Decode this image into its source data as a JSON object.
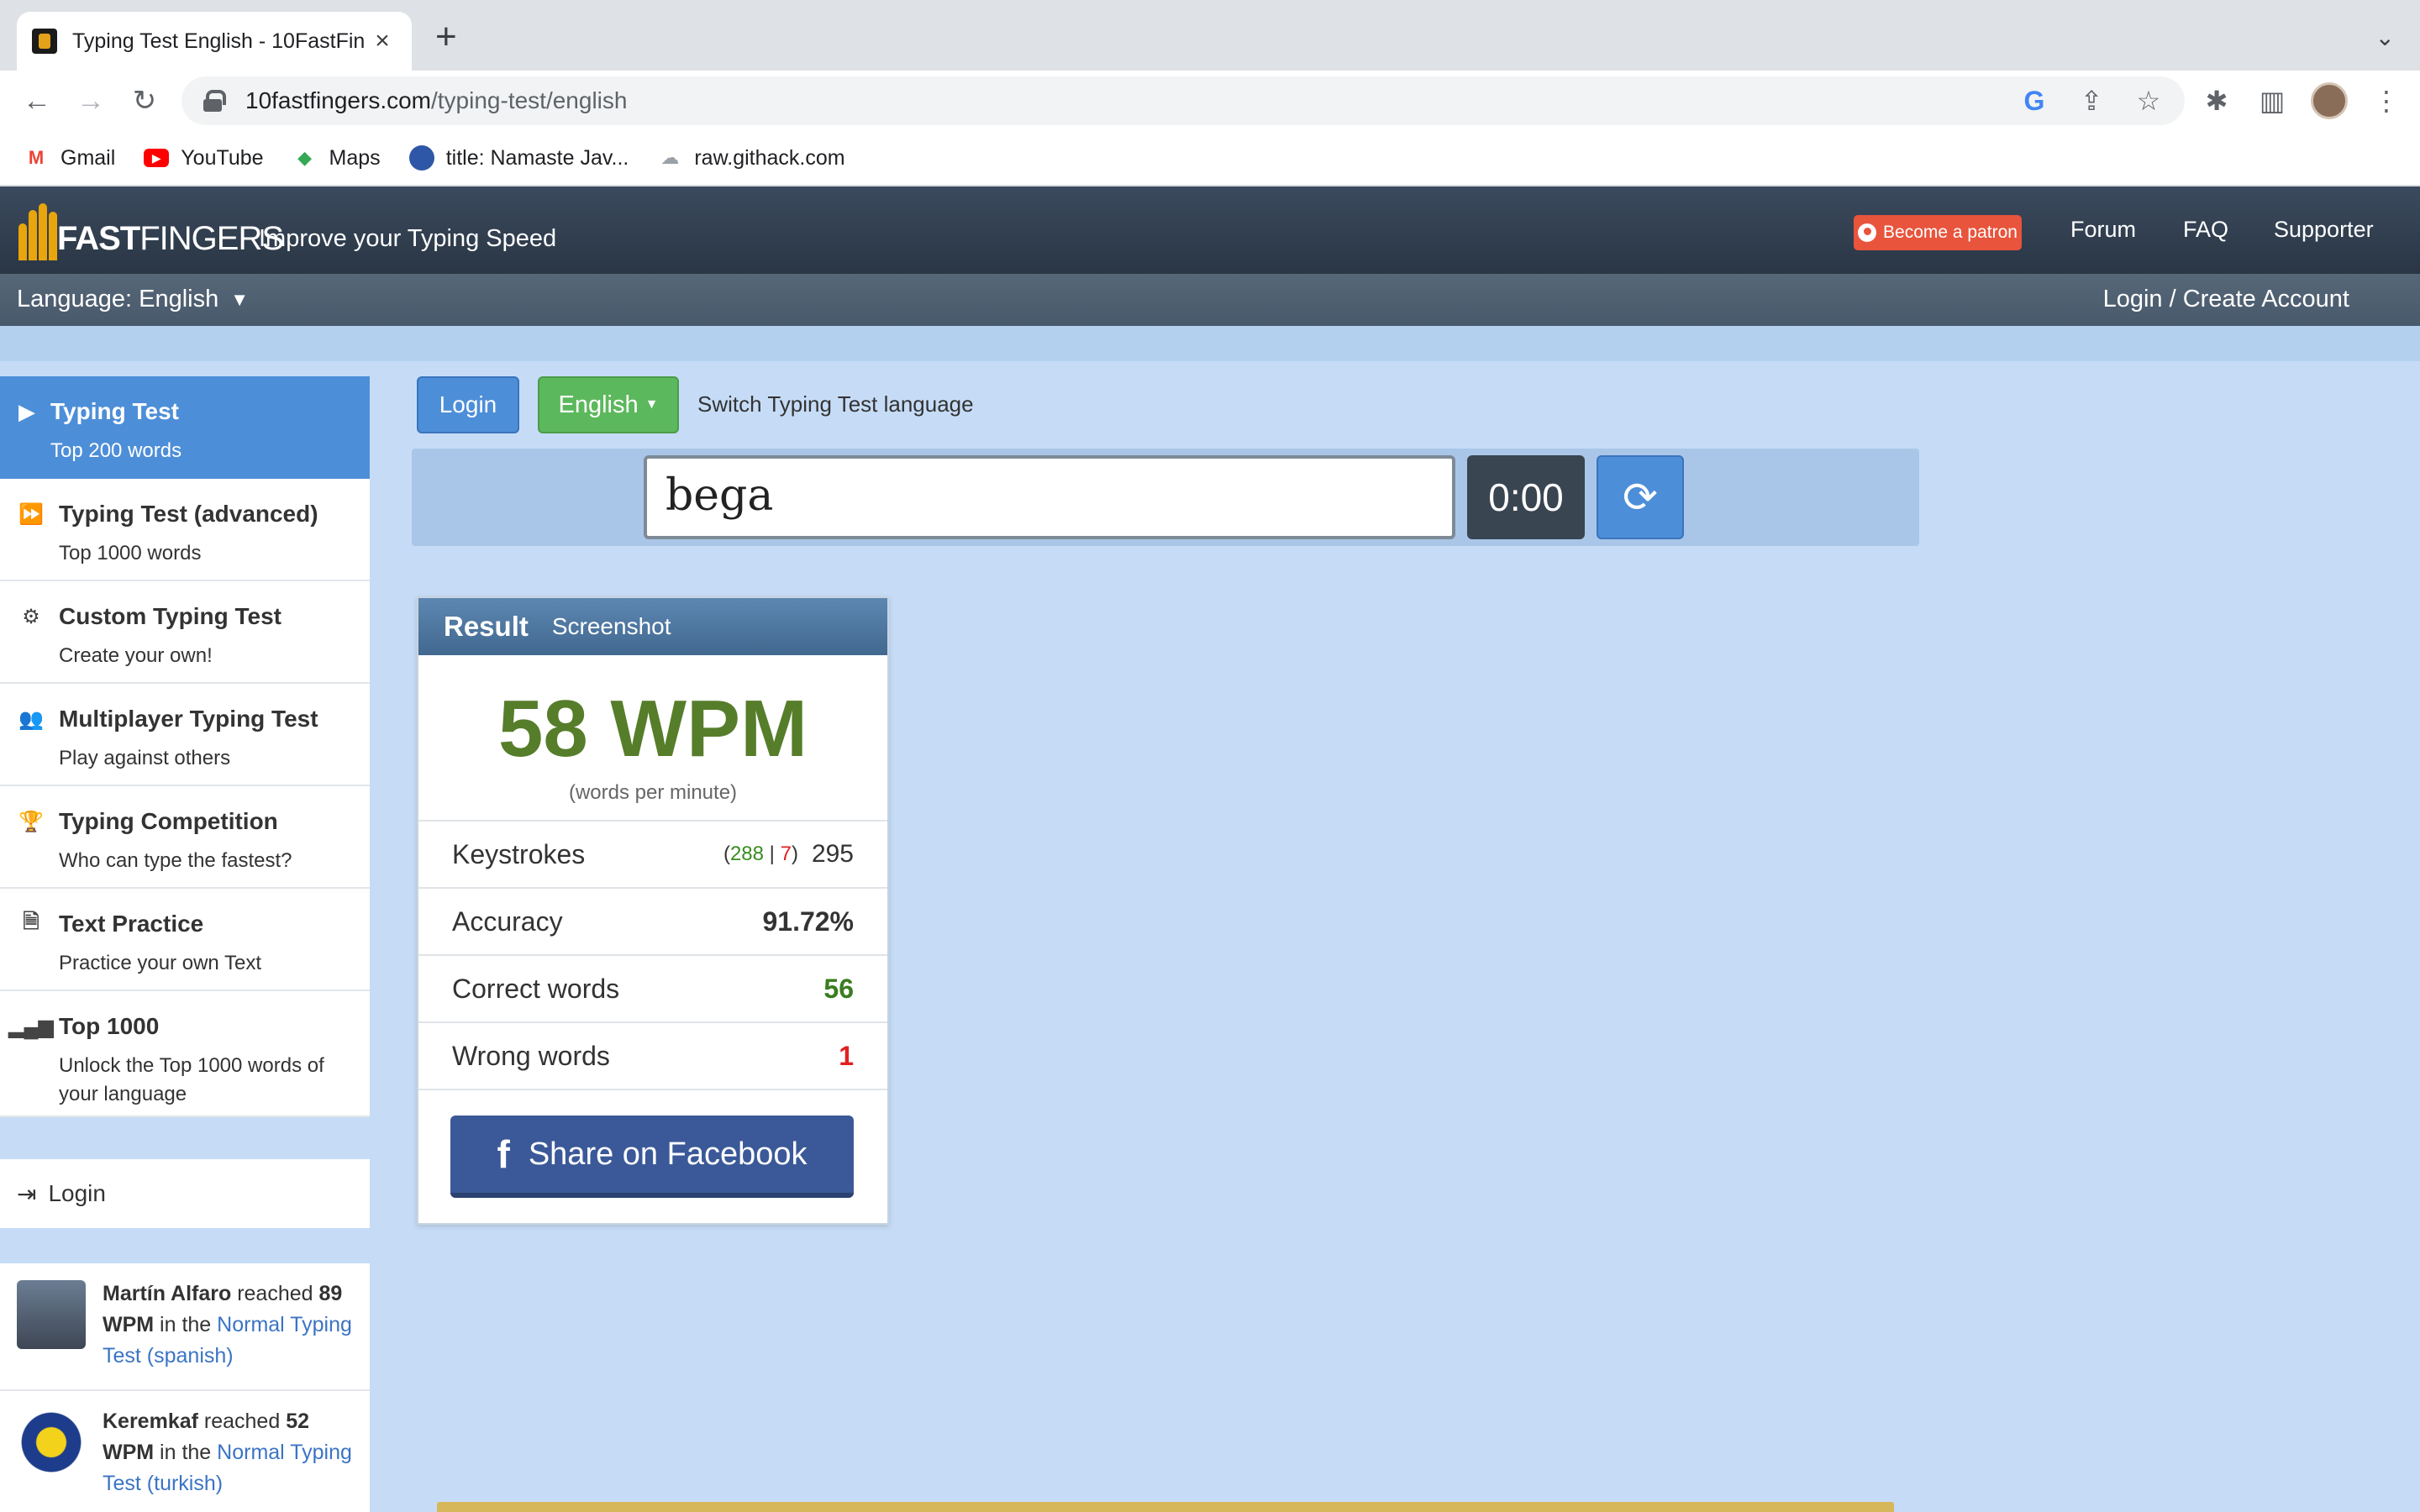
{
  "browser": {
    "tab_title": "Typing Test English - 10FastFin",
    "url_host": "10fastfingers.com",
    "url_path": "/typing-test/english",
    "bookmarks": [
      {
        "label": "Gmail",
        "icon": "gmail-icon"
      },
      {
        "label": "YouTube",
        "icon": "youtube-icon"
      },
      {
        "label": "Maps",
        "icon": "maps-icon"
      },
      {
        "label": "title: Namaste Jav...",
        "icon": "avatar-icon"
      },
      {
        "label": "raw.githack.com",
        "icon": "cloud-icon"
      }
    ]
  },
  "header": {
    "logo_prefix": "FAST",
    "logo_suffix": "FINGERS",
    "tagline": "Improve your Typing Speed",
    "patron": "Become a patron",
    "nav": [
      "Forum",
      "FAQ",
      "Supporter"
    ],
    "language_label": "Language: English",
    "login_create": "Login / Create Account"
  },
  "sidebar": {
    "items": [
      {
        "title": "Typing Test",
        "sub": "Top 200 words",
        "icon": "play-icon"
      },
      {
        "title": "Typing Test (advanced)",
        "sub": "Top 1000 words",
        "icon": "fast-forward-icon"
      },
      {
        "title": "Custom Typing Test",
        "sub": "Create your own!",
        "icon": "gears-icon"
      },
      {
        "title": "Multiplayer Typing Test",
        "sub": "Play against others",
        "icon": "users-icon"
      },
      {
        "title": "Typing Competition",
        "sub": "Who can type the fastest?",
        "icon": "trophy-icon"
      },
      {
        "title": "Text Practice",
        "sub": "Practice your own Text",
        "icon": "document-icon"
      },
      {
        "title": "Top 1000",
        "sub": "Unlock the Top 1000 words of your language",
        "icon": "signal-icon"
      }
    ],
    "login": "Login"
  },
  "feed": [
    {
      "name": "Martín Alfaro",
      "reached": " reached ",
      "wpm": "89 WPM",
      "in_the": " in the ",
      "link": "Normal Typing Test (spanish)"
    },
    {
      "name": "Keremkaf",
      "reached": " reached ",
      "wpm": "52 WPM",
      "in_the": " in the ",
      "link": "Normal Typing Test (turkish)"
    }
  ],
  "main": {
    "login_button": "Login",
    "language_button": "English",
    "switch_text": "Switch Typing Test language",
    "input_value": "bega",
    "timer": "0:00"
  },
  "result": {
    "title": "Result",
    "screenshot": "Screenshot",
    "wpm": "58 WPM",
    "wpm_sub": "(words per minute)",
    "keystrokes_label": "Keystrokes",
    "keystrokes_correct": "288",
    "keystrokes_wrong": "7",
    "keystrokes_total": "295",
    "accuracy_label": "Accuracy",
    "accuracy_value": "91.72%",
    "correct_label": "Correct words",
    "correct_value": "56",
    "wrong_label": "Wrong words",
    "wrong_value": "1",
    "share_label": "Share on Facebook"
  },
  "colors": {
    "accent_blue": "#4d8ed8",
    "wpm_green": "#567d2a",
    "english_green": "#5cb85c",
    "facebook": "#3b5998",
    "patron": "#e8543c"
  }
}
